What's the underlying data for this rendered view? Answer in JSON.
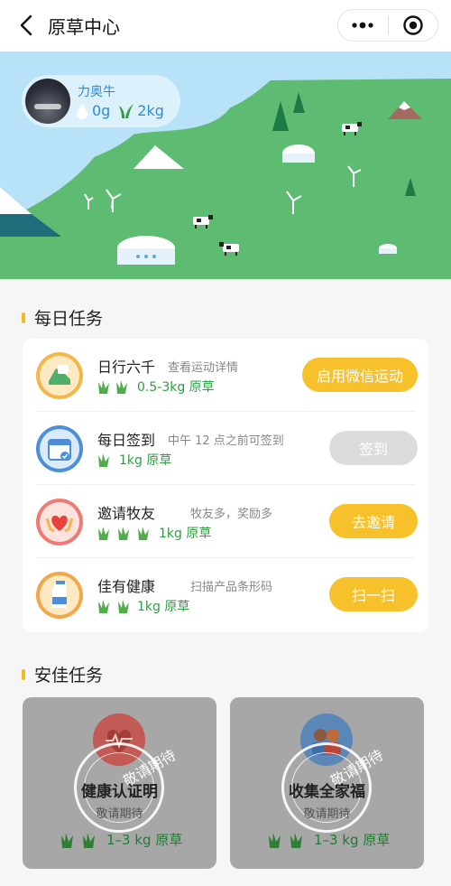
{
  "header": {
    "title": "原草中心"
  },
  "profile": {
    "username": "力奥牛",
    "water": "0g",
    "grass": "2kg"
  },
  "daily_tasks": {
    "section_title": "每日任务",
    "items": [
      {
        "title": "日行六千",
        "subtitle": "查看运动详情",
        "reward": "0.5-3kg 原草",
        "button": "启用微信运动",
        "enabled": true
      },
      {
        "title": "每日签到",
        "subtitle": "中午 12 点之前可签到",
        "reward": "1kg 原草",
        "button": "签到",
        "enabled": false
      },
      {
        "title": "邀请牧友",
        "subtitle": "牧友多，奖励多",
        "reward": "1kg 原草",
        "button": "去邀请",
        "enabled": true
      },
      {
        "title": "佳有健康",
        "subtitle": "扫描产品条形码",
        "reward": "1kg 原草",
        "button": "扫一扫",
        "enabled": true
      }
    ]
  },
  "anjia_tasks": {
    "section_title": "安佳任务",
    "items": [
      {
        "title": "健康认证明",
        "subtitle": "敬请期待",
        "stamp": "敬请期待",
        "reward": "1–3 kg 原草"
      },
      {
        "title": "收集全家福",
        "subtitle": "敬请期待",
        "stamp": "敬请期待",
        "reward": "1–3 kg 原草"
      }
    ]
  },
  "colors": {
    "accent": "#f6c12a",
    "grass_green": "#2e9e43",
    "sky": "#b8e2f8",
    "meadow": "#5dbb72"
  }
}
